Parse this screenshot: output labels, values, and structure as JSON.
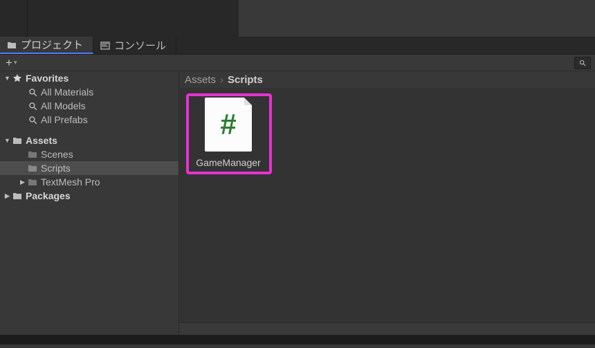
{
  "tabs": {
    "project": "プロジェクト",
    "console": "コンソール"
  },
  "toolbar": {
    "plus": "+"
  },
  "sidebar": {
    "favorites": {
      "label": "Favorites",
      "items": [
        "All Materials",
        "All Models",
        "All Prefabs"
      ]
    },
    "assets": {
      "label": "Assets",
      "children": [
        {
          "label": "Scenes"
        },
        {
          "label": "Scripts"
        },
        {
          "label": "TextMesh Pro"
        }
      ]
    },
    "packages": {
      "label": "Packages"
    }
  },
  "breadcrumb": {
    "root": "Assets",
    "current": "Scripts"
  },
  "assets": {
    "item_name": "GameManager"
  }
}
